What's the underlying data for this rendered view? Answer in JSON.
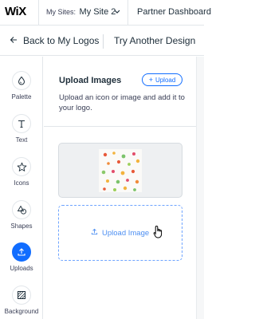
{
  "topbar": {
    "logo": "WiX",
    "sites_prefix": "My Sites:",
    "site_name": "My Site 2",
    "partner": "Partner Dashboard"
  },
  "subbar": {
    "back": "Back to My Logos",
    "try_another": "Try Another Design"
  },
  "rail": {
    "items": [
      {
        "label": "Palette",
        "icon": "palette-icon"
      },
      {
        "label": "Text",
        "icon": "text-icon"
      },
      {
        "label": "Icons",
        "icon": "star-icon"
      },
      {
        "label": "Shapes",
        "icon": "shapes-icon"
      },
      {
        "label": "Uploads",
        "icon": "upload-icon",
        "active": true
      },
      {
        "label": "Background",
        "icon": "background-icon"
      }
    ]
  },
  "panel": {
    "title": "Upload Images",
    "upload_button": "Upload",
    "description": "Upload an icon or image and add it to your logo.",
    "drop_label": "Upload Image"
  },
  "colors": {
    "accent": "#116dff",
    "text": "#20303c",
    "border": "#e2e6ea"
  }
}
